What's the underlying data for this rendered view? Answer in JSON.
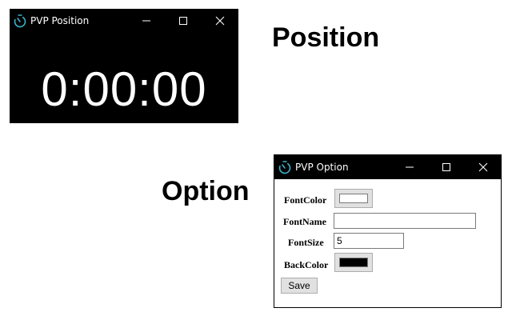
{
  "timer_window": {
    "title": "PVP Position",
    "display": "0:00:00",
    "icon": "timer-icon",
    "background": "#000000",
    "foreground": "#ffffff"
  },
  "captions": {
    "position": "Position",
    "option": "Option"
  },
  "option_window": {
    "title": "PVP Option",
    "icon": "timer-icon",
    "fields": {
      "font_color_label": "FontColor",
      "font_color_value": "#ffffff",
      "font_name_label": "FontName",
      "font_name_value": "",
      "font_size_label": "FontSize",
      "font_size_value": "5",
      "back_color_label": "BackColor",
      "back_color_value": "#000000"
    },
    "save_label": "Save"
  },
  "window_controls": {
    "minimize": "minimize-icon",
    "maximize": "maximize-icon",
    "close": "close-icon"
  }
}
